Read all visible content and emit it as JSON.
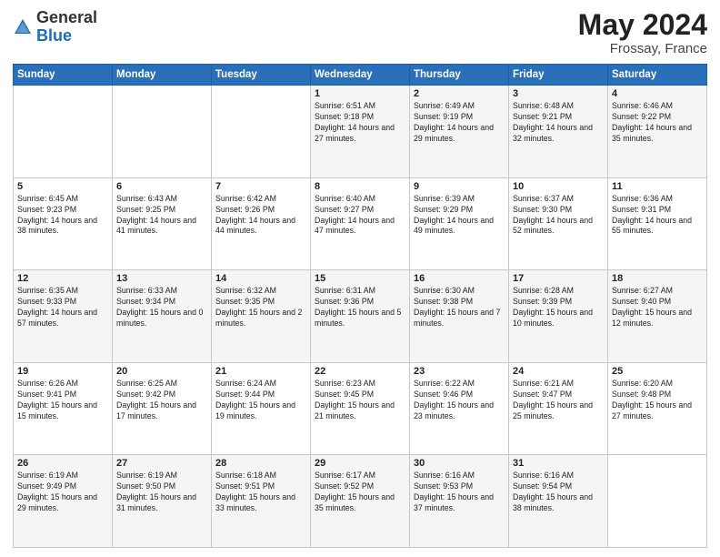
{
  "header": {
    "logo_general": "General",
    "logo_blue": "Blue",
    "month": "May 2024",
    "location": "Frossay, France"
  },
  "days_of_week": [
    "Sunday",
    "Monday",
    "Tuesday",
    "Wednesday",
    "Thursday",
    "Friday",
    "Saturday"
  ],
  "weeks": [
    [
      {
        "day": "",
        "info": ""
      },
      {
        "day": "",
        "info": ""
      },
      {
        "day": "",
        "info": ""
      },
      {
        "day": "1",
        "info": "Sunrise: 6:51 AM\nSunset: 9:18 PM\nDaylight: 14 hours and 27 minutes."
      },
      {
        "day": "2",
        "info": "Sunrise: 6:49 AM\nSunset: 9:19 PM\nDaylight: 14 hours and 29 minutes."
      },
      {
        "day": "3",
        "info": "Sunrise: 6:48 AM\nSunset: 9:21 PM\nDaylight: 14 hours and 32 minutes."
      },
      {
        "day": "4",
        "info": "Sunrise: 6:46 AM\nSunset: 9:22 PM\nDaylight: 14 hours and 35 minutes."
      }
    ],
    [
      {
        "day": "5",
        "info": "Sunrise: 6:45 AM\nSunset: 9:23 PM\nDaylight: 14 hours and 38 minutes."
      },
      {
        "day": "6",
        "info": "Sunrise: 6:43 AM\nSunset: 9:25 PM\nDaylight: 14 hours and 41 minutes."
      },
      {
        "day": "7",
        "info": "Sunrise: 6:42 AM\nSunset: 9:26 PM\nDaylight: 14 hours and 44 minutes."
      },
      {
        "day": "8",
        "info": "Sunrise: 6:40 AM\nSunset: 9:27 PM\nDaylight: 14 hours and 47 minutes."
      },
      {
        "day": "9",
        "info": "Sunrise: 6:39 AM\nSunset: 9:29 PM\nDaylight: 14 hours and 49 minutes."
      },
      {
        "day": "10",
        "info": "Sunrise: 6:37 AM\nSunset: 9:30 PM\nDaylight: 14 hours and 52 minutes."
      },
      {
        "day": "11",
        "info": "Sunrise: 6:36 AM\nSunset: 9:31 PM\nDaylight: 14 hours and 55 minutes."
      }
    ],
    [
      {
        "day": "12",
        "info": "Sunrise: 6:35 AM\nSunset: 9:33 PM\nDaylight: 14 hours and 57 minutes."
      },
      {
        "day": "13",
        "info": "Sunrise: 6:33 AM\nSunset: 9:34 PM\nDaylight: 15 hours and 0 minutes."
      },
      {
        "day": "14",
        "info": "Sunrise: 6:32 AM\nSunset: 9:35 PM\nDaylight: 15 hours and 2 minutes."
      },
      {
        "day": "15",
        "info": "Sunrise: 6:31 AM\nSunset: 9:36 PM\nDaylight: 15 hours and 5 minutes."
      },
      {
        "day": "16",
        "info": "Sunrise: 6:30 AM\nSunset: 9:38 PM\nDaylight: 15 hours and 7 minutes."
      },
      {
        "day": "17",
        "info": "Sunrise: 6:28 AM\nSunset: 9:39 PM\nDaylight: 15 hours and 10 minutes."
      },
      {
        "day": "18",
        "info": "Sunrise: 6:27 AM\nSunset: 9:40 PM\nDaylight: 15 hours and 12 minutes."
      }
    ],
    [
      {
        "day": "19",
        "info": "Sunrise: 6:26 AM\nSunset: 9:41 PM\nDaylight: 15 hours and 15 minutes."
      },
      {
        "day": "20",
        "info": "Sunrise: 6:25 AM\nSunset: 9:42 PM\nDaylight: 15 hours and 17 minutes."
      },
      {
        "day": "21",
        "info": "Sunrise: 6:24 AM\nSunset: 9:44 PM\nDaylight: 15 hours and 19 minutes."
      },
      {
        "day": "22",
        "info": "Sunrise: 6:23 AM\nSunset: 9:45 PM\nDaylight: 15 hours and 21 minutes."
      },
      {
        "day": "23",
        "info": "Sunrise: 6:22 AM\nSunset: 9:46 PM\nDaylight: 15 hours and 23 minutes."
      },
      {
        "day": "24",
        "info": "Sunrise: 6:21 AM\nSunset: 9:47 PM\nDaylight: 15 hours and 25 minutes."
      },
      {
        "day": "25",
        "info": "Sunrise: 6:20 AM\nSunset: 9:48 PM\nDaylight: 15 hours and 27 minutes."
      }
    ],
    [
      {
        "day": "26",
        "info": "Sunrise: 6:19 AM\nSunset: 9:49 PM\nDaylight: 15 hours and 29 minutes."
      },
      {
        "day": "27",
        "info": "Sunrise: 6:19 AM\nSunset: 9:50 PM\nDaylight: 15 hours and 31 minutes."
      },
      {
        "day": "28",
        "info": "Sunrise: 6:18 AM\nSunset: 9:51 PM\nDaylight: 15 hours and 33 minutes."
      },
      {
        "day": "29",
        "info": "Sunrise: 6:17 AM\nSunset: 9:52 PM\nDaylight: 15 hours and 35 minutes."
      },
      {
        "day": "30",
        "info": "Sunrise: 6:16 AM\nSunset: 9:53 PM\nDaylight: 15 hours and 37 minutes."
      },
      {
        "day": "31",
        "info": "Sunrise: 6:16 AM\nSunset: 9:54 PM\nDaylight: 15 hours and 38 minutes."
      },
      {
        "day": "",
        "info": ""
      }
    ]
  ]
}
